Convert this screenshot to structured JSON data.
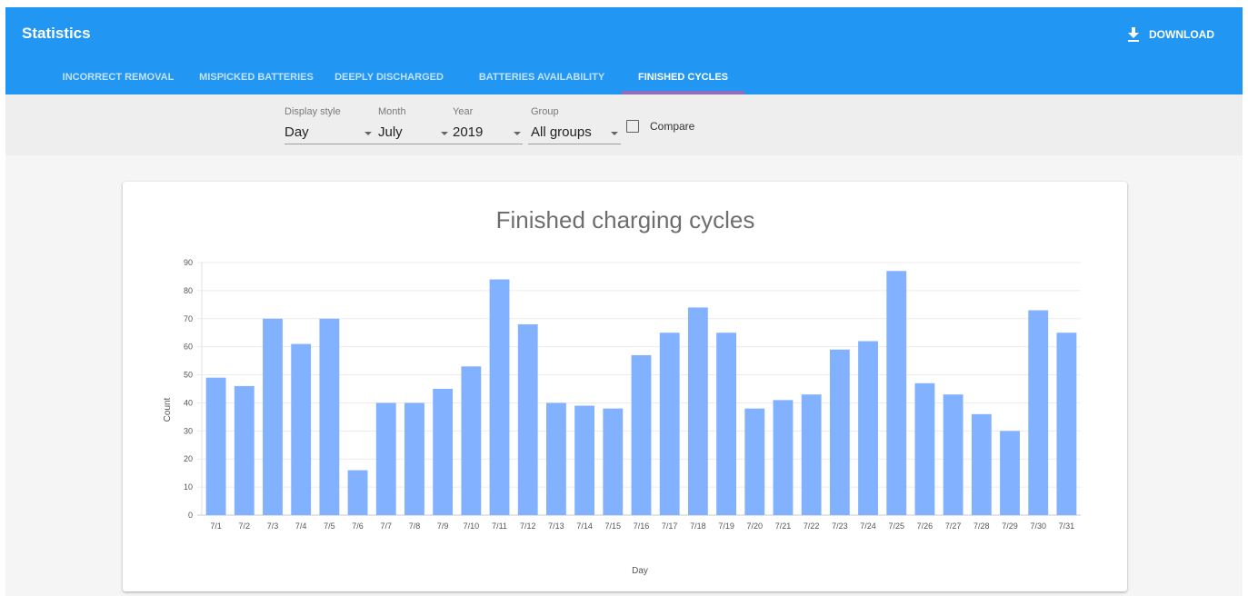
{
  "app": {
    "title": "Statistics",
    "download_label": "DOWNLOAD",
    "download_icon": "download-icon",
    "accent_color": "#2196f3",
    "indicator_color": "#ff4081",
    "bar_color": "#82b1ff"
  },
  "tabs": [
    {
      "label": "INCORRECT REMOVAL",
      "active": false
    },
    {
      "label": "MISPICKED BATTERIES",
      "active": false
    },
    {
      "label": "DEEPLY DISCHARGED",
      "active": false
    },
    {
      "label": "BATTERIES AVAILABILITY",
      "active": false
    },
    {
      "label": "FINISHED CYCLES",
      "active": true
    }
  ],
  "filters": {
    "display_style": {
      "label": "Display style",
      "value": "Day"
    },
    "month": {
      "label": "Month",
      "value": "July"
    },
    "year": {
      "label": "Year",
      "value": "2019"
    },
    "group": {
      "label": "Group",
      "value": "All groups"
    },
    "compare": {
      "label": "Compare",
      "checked": false
    }
  },
  "chart_data": {
    "type": "bar",
    "title": "Finished charging cycles",
    "xlabel": "Day",
    "ylabel": "Count",
    "ylim": [
      0,
      90
    ],
    "yticks": [
      0,
      10,
      20,
      30,
      40,
      50,
      60,
      70,
      80,
      90
    ],
    "grid": true,
    "categories": [
      "7/1",
      "7/2",
      "7/3",
      "7/4",
      "7/5",
      "7/6",
      "7/7",
      "7/8",
      "7/9",
      "7/10",
      "7/11",
      "7/12",
      "7/13",
      "7/14",
      "7/15",
      "7/16",
      "7/17",
      "7/18",
      "7/19",
      "7/20",
      "7/21",
      "7/22",
      "7/23",
      "7/24",
      "7/25",
      "7/26",
      "7/27",
      "7/28",
      "7/29",
      "7/30",
      "7/31"
    ],
    "values": [
      49,
      46,
      70,
      61,
      70,
      16,
      40,
      40,
      45,
      53,
      84,
      68,
      40,
      39,
      38,
      57,
      65,
      74,
      65,
      38,
      41,
      43,
      59,
      62,
      87,
      47,
      43,
      36,
      30,
      73,
      65
    ]
  }
}
